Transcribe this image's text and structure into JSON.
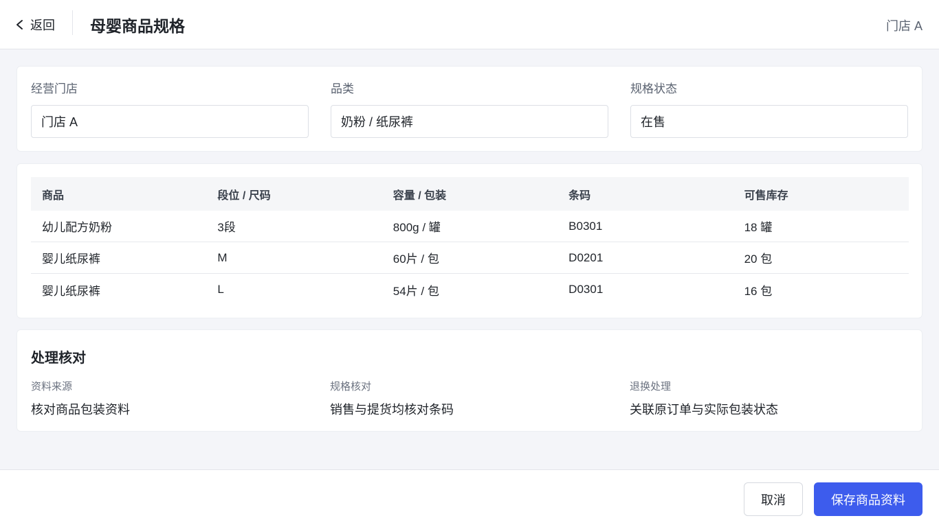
{
  "header": {
    "back_label": "返回",
    "title": "母婴商品规格",
    "store": "门店 A"
  },
  "filters": [
    {
      "label": "经营门店",
      "value": "门店 A"
    },
    {
      "label": "品类",
      "value": "奶粉 / 纸尿裤"
    },
    {
      "label": "规格状态",
      "value": "在售"
    }
  ],
  "table": {
    "columns": [
      "商品",
      "段位 / 尺码",
      "容量 / 包装",
      "条码",
      "可售库存"
    ],
    "rows": [
      [
        "幼儿配方奶粉",
        "3段",
        "800g / 罐",
        "B0301",
        "18 罐"
      ],
      [
        "婴儿纸尿裤",
        "M",
        "60片 / 包",
        "D0201",
        "20 包"
      ],
      [
        "婴儿纸尿裤",
        "L",
        "54片 / 包",
        "D0301",
        "16 包"
      ]
    ]
  },
  "check": {
    "title": "处理核对",
    "items": [
      {
        "label": "资料来源",
        "value": "核对商品包装资料"
      },
      {
        "label": "规格核对",
        "value": "销售与提货均核对条码"
      },
      {
        "label": "退换处理",
        "value": "关联原订单与实际包装状态"
      }
    ]
  },
  "footer": {
    "cancel_label": "取消",
    "save_label": "保存商品资料"
  },
  "colors": {
    "accent": "#3d5ced",
    "background": "#f4f5f9"
  }
}
